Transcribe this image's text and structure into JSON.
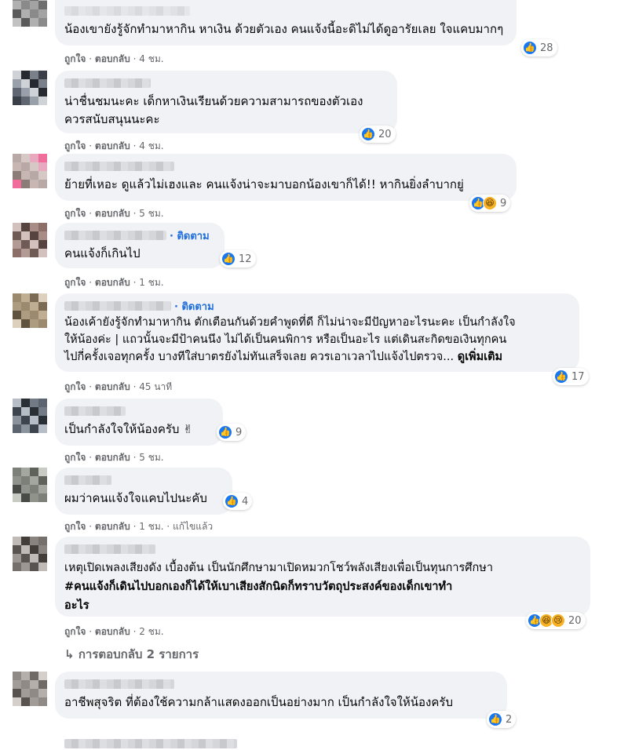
{
  "comments": [
    {
      "follow": "",
      "lines": [
        "น้องเขายังรู้จักทำมาหากิน หาเงิน ด้วยตัวเอง คนแจ้งนี้อะดิไม่ได้ดูอารัยเลย ใจแคบมากๆ"
      ],
      "like_label": "ถูกใจ",
      "reply_label": "ตอบกลับ",
      "time": "4 ชม.",
      "edited": "",
      "reactions": [
        "like-icon"
      ],
      "reaction_count": "28"
    },
    {
      "follow": "",
      "lines": [
        "น่าชื่นชมนะคะ เด็กหาเงินเรียนด้วยความสามารถของตัวเอง",
        "ควรสนับสนุนนะคะ"
      ],
      "like_label": "ถูกใจ",
      "reply_label": "ตอบกลับ",
      "time": "4 ชม.",
      "edited": "",
      "reactions": [
        "like-icon"
      ],
      "reaction_count": "20"
    },
    {
      "follow": "",
      "lines": [
        "ย้ายที่เหอะ ดูแล้วไม่เฮงและ คนแจ้งน่าจะมาบอกน้องเขาก็ได้!! หากินยิ่งลำบากยู่"
      ],
      "like_label": "ถูกใจ",
      "reply_label": "ตอบกลับ",
      "time": "5 ชม.",
      "edited": "",
      "reactions": [
        "like-icon",
        "haha-icon"
      ],
      "reaction_count": "9"
    },
    {
      "follow": "ติดตาม",
      "lines": [
        "คนแจ้งก็เกินไป"
      ],
      "like_label": "ถูกใจ",
      "reply_label": "ตอบกลับ",
      "time": "1 ชม.",
      "edited": "",
      "reactions": [
        "like-icon"
      ],
      "reaction_count": "12"
    },
    {
      "follow": "ติดตาม",
      "lines": [
        "น้องเค้ายังรู้จักทำมาหากิน ตักเตือนกันด้วยคำพูดที่ดี ก็ไม่น่าจะมีปัญหาอะไรนะคะ เป็นกำลังใจ",
        "ให้น้องค่ะ | แถวนั้นจะมีป้าคนนึง ไม่ได้เป็นคนพิการ หรือเป็นอะไร แต่เดินสะกิดขอเงินทุกคน",
        "ไปกี่ครั้งเจอทุกครั้ง บางทีใส่บาตรยังไม่ทันเสร็จเลย ควรเอาเวลาไปแจ้งไปตรวจ..."
      ],
      "see_more": "ดูเพิ่มเติม",
      "like_label": "ถูกใจ",
      "reply_label": "ตอบกลับ",
      "time": "45 นาที",
      "edited": "",
      "reactions": [
        "like-icon"
      ],
      "reaction_count": "17"
    },
    {
      "follow": "",
      "lines": [
        "เป็นกำลังใจให้น้องครับ ✌"
      ],
      "like_label": "ถูกใจ",
      "reply_label": "ตอบกลับ",
      "time": "5 ชม.",
      "edited": "",
      "reactions": [
        "like-icon"
      ],
      "reaction_count": "9"
    },
    {
      "follow": "",
      "lines": [
        "ผมว่าคนแจ้งใจแคบไปนะคับ"
      ],
      "like_label": "ถูกใจ",
      "reply_label": "ตอบกลับ",
      "time": "1 ชม.",
      "edited": "แก้ไขแล้ว",
      "reactions": [
        "like-icon"
      ],
      "reaction_count": "4"
    },
    {
      "follow": "",
      "lines": [
        "เหตุเปิดเพลงเสียงดัง เบื้องต้น เป็นนักศึกษามาเปิดหมวกโชว์พลังเสียงเพื่อเป็นทุนการศึกษา"
      ],
      "bold_lines": [
        "#คนแจ้งก็เดินไปบอกเองก็ได้ให้เบาเสียงสักนิดก็ทราบวัตถุประสงค์ของเด็กเขาทำ",
        "อะไร"
      ],
      "like_label": "ถูกใจ",
      "reply_label": "ตอบกลับ",
      "time": "2 ชม.",
      "edited": "",
      "reactions": [
        "like-icon",
        "haha-icon",
        "sad-icon"
      ],
      "reaction_count": "20",
      "replies": "การตอบกลับ 2 รายการ"
    },
    {
      "follow": "",
      "lines": [
        "อาชีพสุจริต ที่ต้องใช้ความกล้าแสดงออกเป็นอย่างมาก เป็นกำลังใจให้น้องครับ"
      ],
      "like_label": "",
      "reply_label": "",
      "time": "",
      "edited": "",
      "reactions": [
        "like-icon"
      ],
      "reaction_count": "2"
    }
  ],
  "colors": {
    "bubble": "#f0f2f5",
    "like": "#1877f2",
    "follow": "#216fdb",
    "meta": "#65676b"
  },
  "separator": "·",
  "reply_arrow": "↳"
}
